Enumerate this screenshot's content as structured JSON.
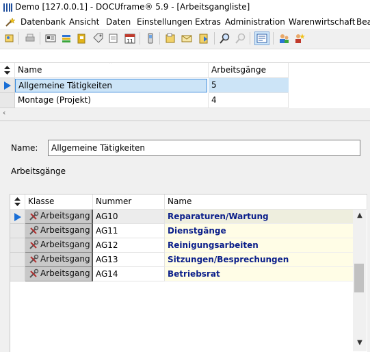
{
  "window": {
    "title": "Demo [127.0.0.1] - DOCUframe® 5.9 - [Arbeitsgangliste]"
  },
  "menu": {
    "items": [
      "Datenbank",
      "Ansicht",
      "Daten",
      "Einstellungen",
      "Extras",
      "Administration",
      "Warenwirtschaft",
      "Bea"
    ]
  },
  "upper_grid": {
    "columns": [
      "Name",
      "Arbeitsgänge"
    ],
    "rows": [
      {
        "name": "Allgemeine Tätigkeiten",
        "count": "5",
        "selected": true
      },
      {
        "name": "Montage (Projekt)",
        "count": "4",
        "selected": false
      }
    ]
  },
  "detail": {
    "name_label": "Name:",
    "name_value": "Allgemeine Tätigkeiten",
    "section_label": "Arbeitsgänge"
  },
  "lower_grid": {
    "columns": [
      "Klasse",
      "Nummer",
      "Name"
    ],
    "rows": [
      {
        "klasse": "Arbeitsgang",
        "nummer": "AG10",
        "name": "Reparaturen/Wartung",
        "current": true
      },
      {
        "klasse": "Arbeitsgang",
        "nummer": "AG11",
        "name": "Dienstgänge",
        "current": false
      },
      {
        "klasse": "Arbeitsgang",
        "nummer": "AG12",
        "name": "Reinigungsarbeiten",
        "current": false
      },
      {
        "klasse": "Arbeitsgang",
        "nummer": "AG13",
        "name": "Sitzungen/Besprechungen",
        "current": false
      },
      {
        "klasse": "Arbeitsgang",
        "nummer": "AG14",
        "name": "Betriebsrat",
        "current": false
      }
    ]
  },
  "colors": {
    "selection": "#cce4f7",
    "name_text": "#0b1f8a",
    "name_bg": "#fffde6",
    "row_indicator": "#1a6fd6"
  },
  "icons": {
    "toolbar": [
      "new-icon",
      "print-icon",
      "card-icon",
      "list-icon",
      "folder-icon",
      "tag-icon",
      "notes-icon",
      "calendar-icon",
      "phone-icon",
      "doc-icon",
      "email-icon",
      "import-icon",
      "search-icon",
      "search-disabled-icon",
      "layout-icon",
      "people-icon",
      "people-star-icon"
    ]
  }
}
